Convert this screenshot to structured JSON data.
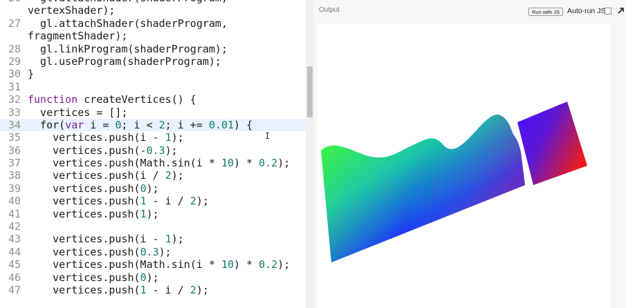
{
  "editor": {
    "lines": [
      {
        "num": "26",
        "text": "  gl.attachShader(shaderProgram,"
      },
      {
        "num": "",
        "text": "vertexShader);"
      },
      {
        "num": "27",
        "text": "  gl.attachShader(shaderProgram,"
      },
      {
        "num": "",
        "text": "fragmentShader);"
      },
      {
        "num": "28",
        "text": "  gl.linkProgram(shaderProgram);"
      },
      {
        "num": "29",
        "text": "  gl.useProgram(shaderProgram);"
      },
      {
        "num": "30",
        "text": "}"
      },
      {
        "num": "31",
        "text": ""
      },
      {
        "num": "32",
        "text": "function createVertices() {"
      },
      {
        "num": "33",
        "text": "  vertices = [];"
      },
      {
        "num": "34",
        "text": "  for(var i = 0; i < 2; i += 0.01) {",
        "active": true
      },
      {
        "num": "35",
        "text": "    vertices.push(i - 1);"
      },
      {
        "num": "36",
        "text": "    vertices.push(-0.3);"
      },
      {
        "num": "37",
        "text": "    vertices.push(Math.sin(i * 10) * 0.2);"
      },
      {
        "num": "38",
        "text": "    vertices.push(i / 2);"
      },
      {
        "num": "39",
        "text": "    vertices.push(0);"
      },
      {
        "num": "40",
        "text": "    vertices.push(1 - i / 2);"
      },
      {
        "num": "41",
        "text": "    vertices.push(1);"
      },
      {
        "num": "42",
        "text": ""
      },
      {
        "num": "43",
        "text": "    vertices.push(i - 1);"
      },
      {
        "num": "44",
        "text": "    vertices.push(0.3);"
      },
      {
        "num": "45",
        "text": "    vertices.push(Math.sin(i * 10) * 0.2);"
      },
      {
        "num": "46",
        "text": "    vertices.push(0);"
      },
      {
        "num": "47",
        "text": "    vertices.push(1 - i / 2);"
      }
    ]
  },
  "output": {
    "title": "Output",
    "run_button": "Run with JS",
    "autorun_label": "Auto-run JS"
  },
  "icons": {
    "expand": "expand-arrow-icon",
    "text_cursor": "text-cursor-icon"
  },
  "colors": {
    "keyword": "#7a1f9a",
    "number": "#117a6d",
    "active_line": "#e8f2ff",
    "line_number": "#8f8f8f"
  }
}
